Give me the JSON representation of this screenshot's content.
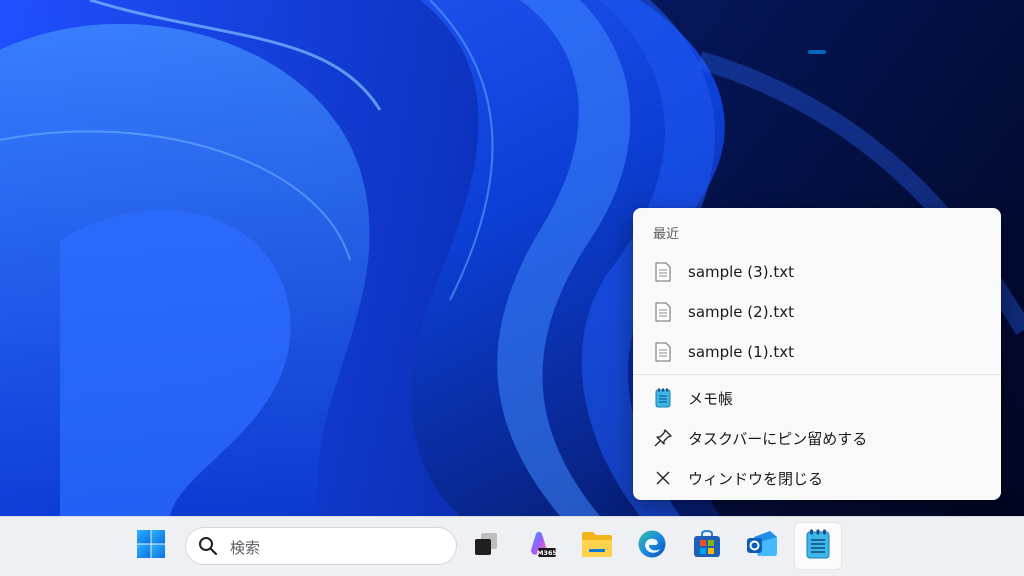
{
  "jumplist": {
    "recent_title": "最近",
    "recent_items": [
      {
        "label": "sample (3).txt",
        "icon": "text-file-icon"
      },
      {
        "label": "sample (2).txt",
        "icon": "text-file-icon"
      },
      {
        "label": "sample (1).txt",
        "icon": "text-file-icon"
      }
    ],
    "actions": [
      {
        "label": "メモ帳",
        "icon": "notepad-icon"
      },
      {
        "label": "タスクバーにピン留めする",
        "icon": "pin-icon"
      },
      {
        "label": "ウィンドウを閉じる",
        "icon": "close-icon"
      }
    ]
  },
  "taskbar": {
    "search_placeholder": "検索",
    "apps": [
      {
        "name": "start",
        "icon": "windows-logo-icon"
      },
      {
        "name": "task-view",
        "icon": "task-view-icon"
      },
      {
        "name": "microsoft-365",
        "icon": "m365-icon",
        "badge": "M365"
      },
      {
        "name": "file-explorer",
        "icon": "folder-icon"
      },
      {
        "name": "edge",
        "icon": "edge-icon"
      },
      {
        "name": "store",
        "icon": "store-icon"
      },
      {
        "name": "outlook",
        "icon": "outlook-icon"
      },
      {
        "name": "notepad",
        "icon": "notepad-icon",
        "active": true
      }
    ]
  },
  "colors": {
    "accent": "#0067c0",
    "wallpaper_base": "#0a2a9e",
    "jumplist_bg": "#f9f9f9",
    "taskbar_bg": "#eef0f4"
  }
}
